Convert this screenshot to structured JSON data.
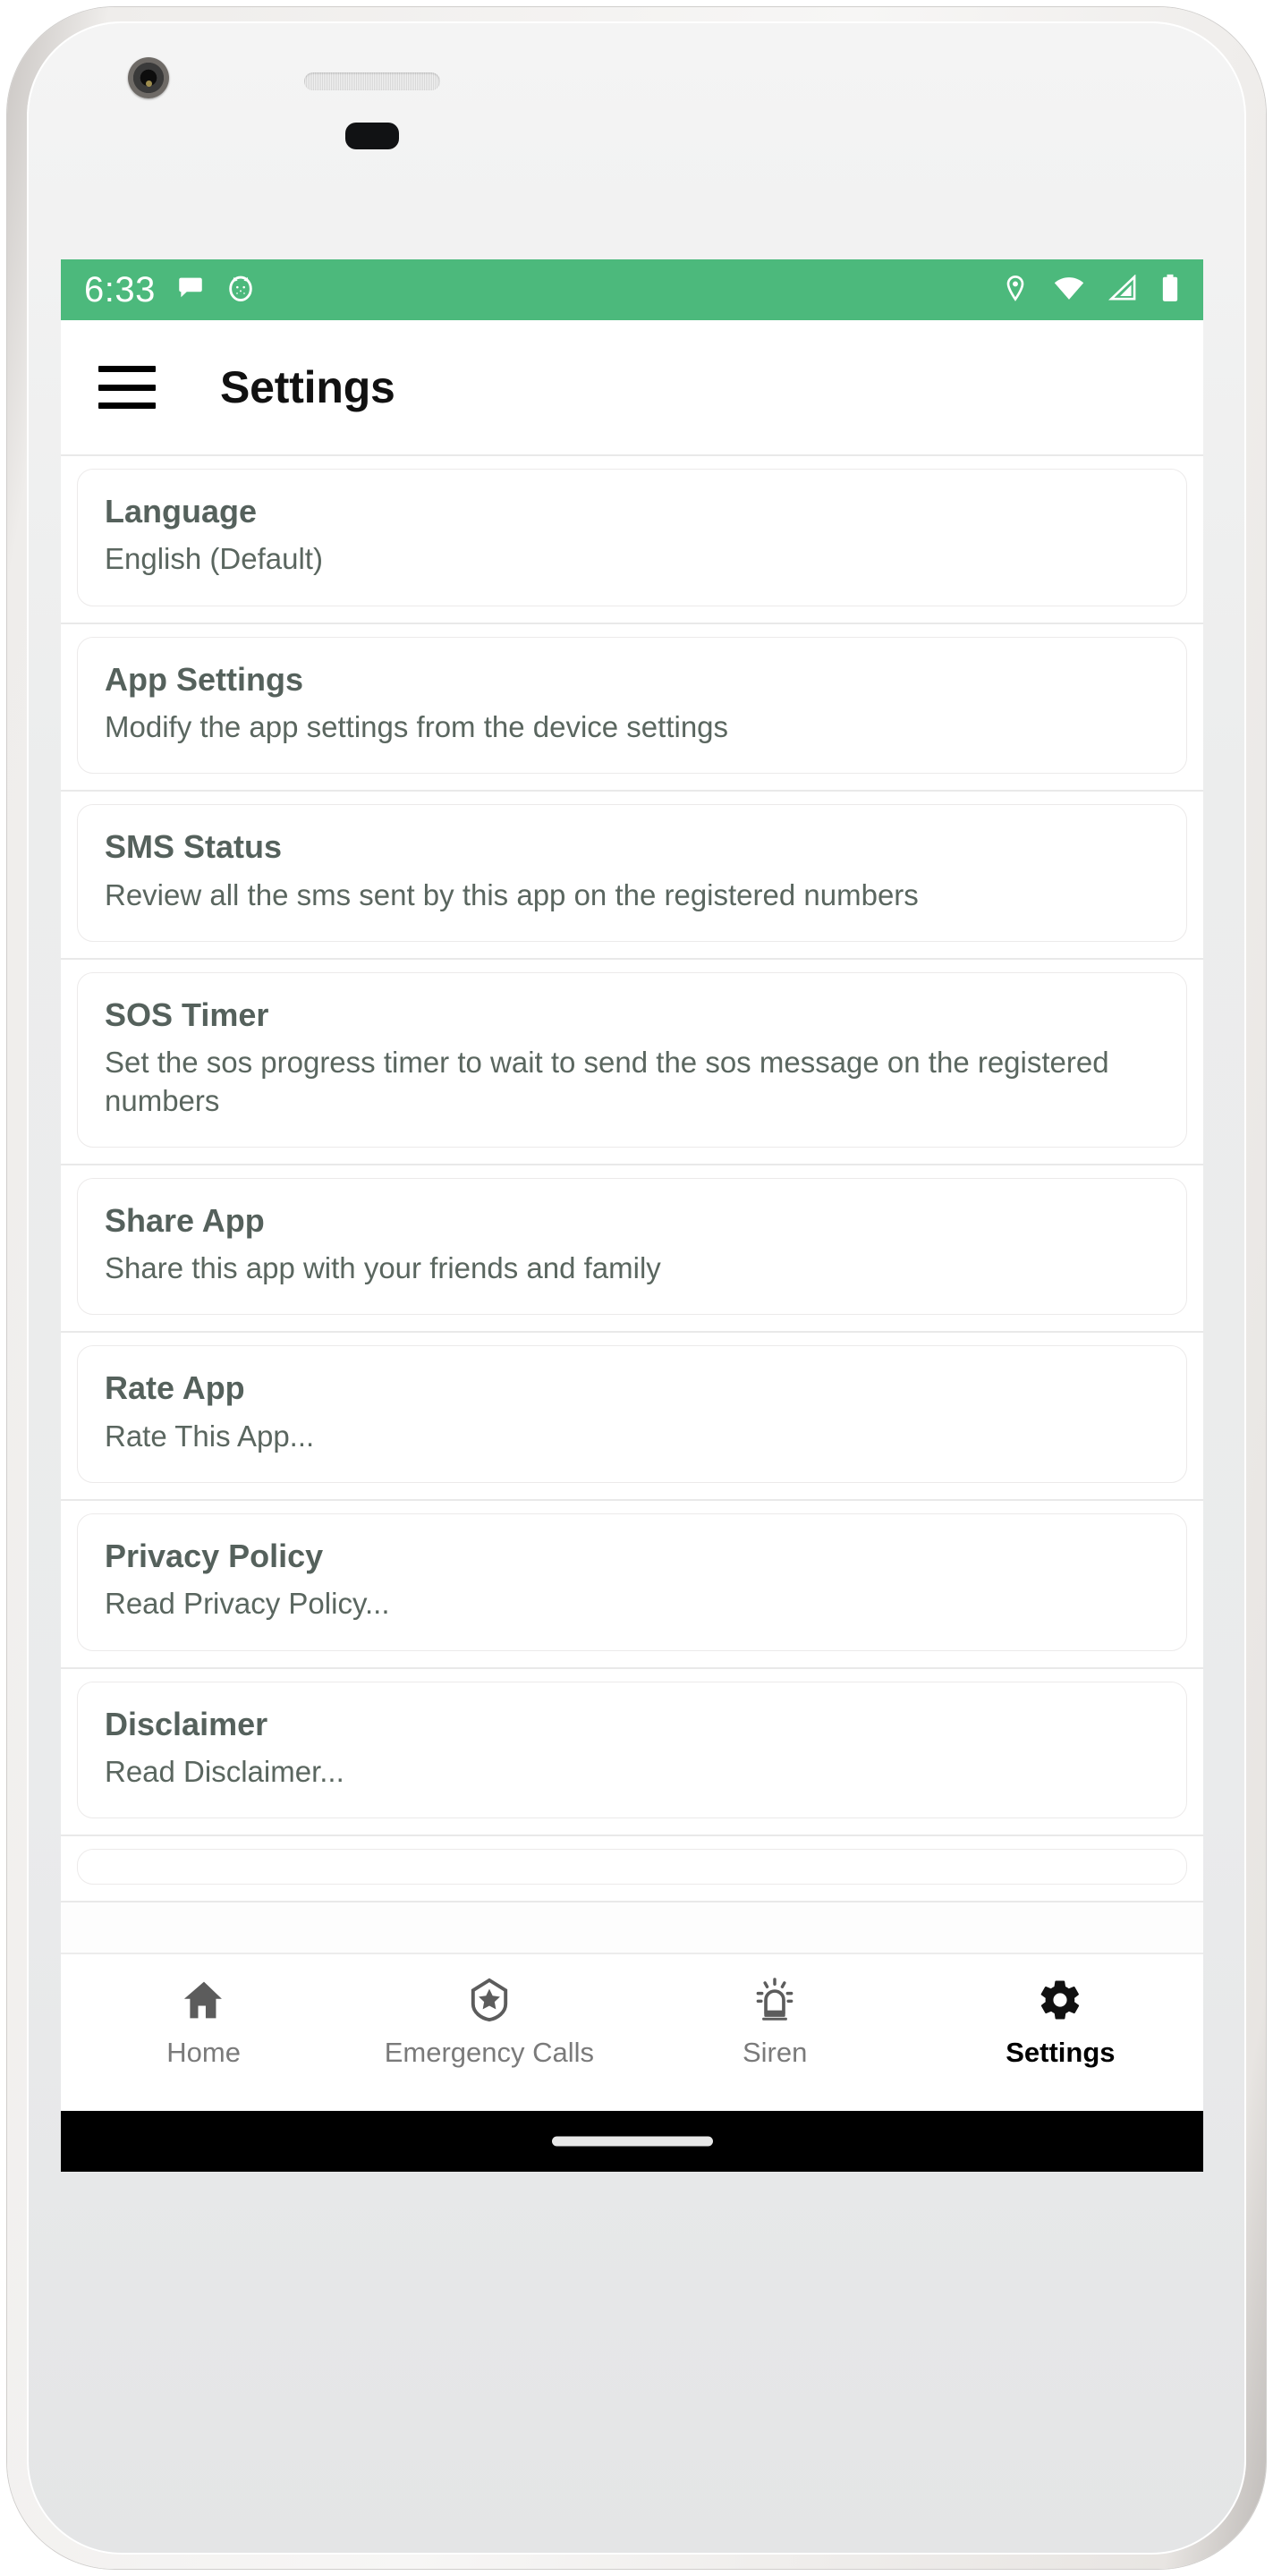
{
  "status_bar": {
    "time": "6:33",
    "left_icons": [
      "message-bubble-icon",
      "cat-face-icon"
    ],
    "right_icons": [
      "location-pin-icon",
      "wifi-icon",
      "cellular-signal-icon",
      "battery-icon"
    ],
    "background_color": "#4cb97c"
  },
  "app_bar": {
    "menu_icon": "hamburger-menu-icon",
    "title": "Settings"
  },
  "settings": {
    "items": [
      {
        "title": "Language",
        "subtitle": "English (Default)"
      },
      {
        "title": "App Settings",
        "subtitle": "Modify the app settings from the device settings"
      },
      {
        "title": "SMS Status",
        "subtitle": "Review all the sms sent by this app on the registered numbers"
      },
      {
        "title": "SOS Timer",
        "subtitle": "Set the sos progress timer to wait to send the sos message on the registered numbers"
      },
      {
        "title": "Share App",
        "subtitle": "Share this app with your friends and family"
      },
      {
        "title": "Rate App",
        "subtitle": "Rate This App..."
      },
      {
        "title": "Privacy Policy",
        "subtitle": "Read Privacy Policy..."
      },
      {
        "title": "Disclaimer",
        "subtitle": "Read Disclaimer..."
      }
    ]
  },
  "bottom_nav": {
    "items": [
      {
        "label": "Home",
        "icon": "home-icon",
        "active": false
      },
      {
        "label": "Emergency Calls",
        "icon": "shield-star-icon",
        "active": false
      },
      {
        "label": "Siren",
        "icon": "siren-icon",
        "active": false
      },
      {
        "label": "Settings",
        "icon": "gear-icon",
        "active": true
      }
    ]
  },
  "colors": {
    "accent_green": "#4cb97c",
    "title_text": "#55615c",
    "subtitle_text": "#5a665f",
    "nav_inactive": "#7a7a7a",
    "nav_active": "#000000"
  }
}
